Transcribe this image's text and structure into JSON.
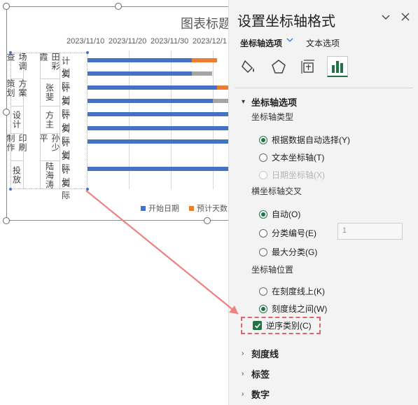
{
  "chart": {
    "title": "图表标题",
    "dates": [
      "2023/11/10",
      "2023/11/20",
      "2023/11/30",
      "2023/12/1"
    ],
    "legend": [
      {
        "label": "开始日期",
        "color": "#4472c4"
      },
      {
        "label": "预计天数",
        "color": "#ed7d31"
      }
    ],
    "categories": {
      "stage": [
        "场调查",
        "方案策划",
        "设计",
        "印刷制作",
        "投放"
      ],
      "owner": [
        "田彩霞",
        "张斐",
        "方主",
        "孙少平",
        "陆海涛"
      ],
      "rows": [
        "计划",
        "实际",
        "计划",
        "实际",
        "计划",
        "实际",
        "计划",
        "实际",
        "计划",
        "实际"
      ]
    }
  },
  "chart_data": {
    "type": "bar",
    "title": "图表标题",
    "x_tick_labels": [
      "2023/11/10",
      "2023/11/20",
      "2023/11/30",
      "2023/12/1"
    ],
    "series": [
      {
        "name": "开始日期",
        "color": "#4472c4"
      },
      {
        "name": "预计天数",
        "color": "#ed7d31"
      }
    ]
  },
  "pane": {
    "title": "设置坐标轴格式",
    "dropdown_icon": "chevron-down-icon",
    "close_icon": "close-icon",
    "tabs": [
      "坐标轴选项",
      "文本选项"
    ],
    "section_axis_options": "坐标轴选项",
    "axis_type_label": "坐标轴类型",
    "axis_type_options": [
      "根据数据自动选择(Y)",
      "文本坐标轴(T)",
      "日期坐标轴(X)"
    ],
    "cross_label": "横坐标轴交叉",
    "cross_options": [
      "自动(O)",
      "分类编号(E)",
      "最大分类(G)"
    ],
    "cross_value": "1",
    "position_label": "坐标轴位置",
    "position_options": [
      "在刻度线上(K)",
      "刻度线之间(W)"
    ],
    "reverse_label": "逆序类别(C)",
    "collapsed_sections": [
      "刻度线",
      "标签",
      "数字"
    ]
  }
}
